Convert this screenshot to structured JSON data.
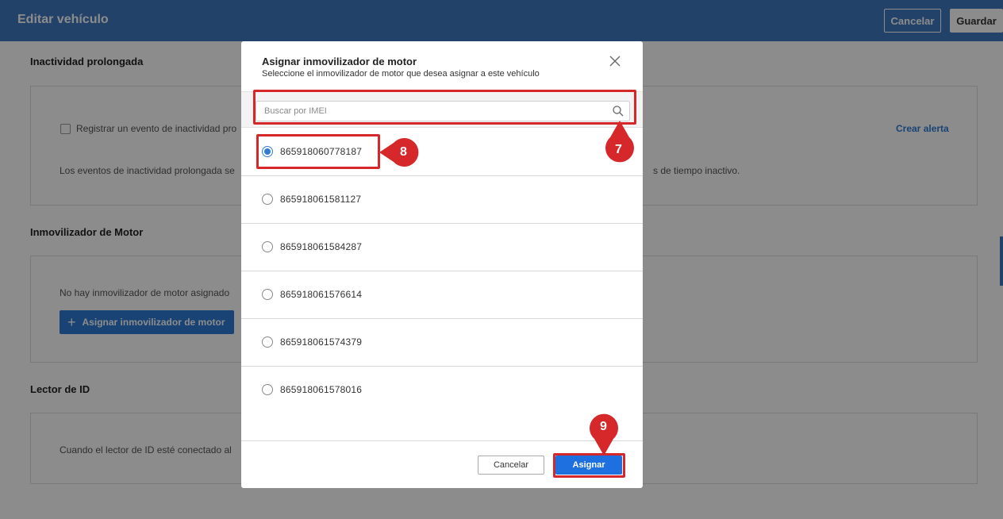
{
  "header": {
    "title": "Editar vehículo",
    "cancel_label": "Cancelar",
    "save_label": "Guardar"
  },
  "sections": {
    "idle": {
      "title": "Inactividad prolongada",
      "checkbox_label": "Registrar un evento de inactividad pro",
      "create_alert_label": "Crear alerta",
      "description_start": "Los eventos de inactividad prolongada se",
      "description_end": "s de tiempo inactivo."
    },
    "immobilizer": {
      "title": "Inmovilizador de Motor",
      "empty_text": "No hay inmovilizador de motor asignado",
      "assign_button_label": "Asignar inmovilizador de motor"
    },
    "id_reader": {
      "title": "Lector de ID",
      "description": "Cuando el lector de ID esté conectado al"
    }
  },
  "modal": {
    "title": "Asignar inmovilizador de motor",
    "subtitle": "Seleccione el inmovilizador de motor que desea asignar a este vehículo",
    "search_placeholder": "Buscar por IMEI",
    "search_value": "",
    "items": [
      {
        "imei": "865918060778187",
        "selected": true
      },
      {
        "imei": "865918061581127",
        "selected": false
      },
      {
        "imei": "865918061584287",
        "selected": false
      },
      {
        "imei": "865918061576614",
        "selected": false
      },
      {
        "imei": "865918061574379",
        "selected": false
      },
      {
        "imei": "865918061578016",
        "selected": false
      }
    ],
    "cancel_label": "Cancelar",
    "assign_label": "Asignar"
  },
  "callouts": {
    "search": "7",
    "first_item": "8",
    "assign": "9"
  },
  "colors": {
    "header": "#3e78c0",
    "accent": "#2f7bd6",
    "assign_button": "#1e6fe0",
    "callout": "#d6282b"
  }
}
